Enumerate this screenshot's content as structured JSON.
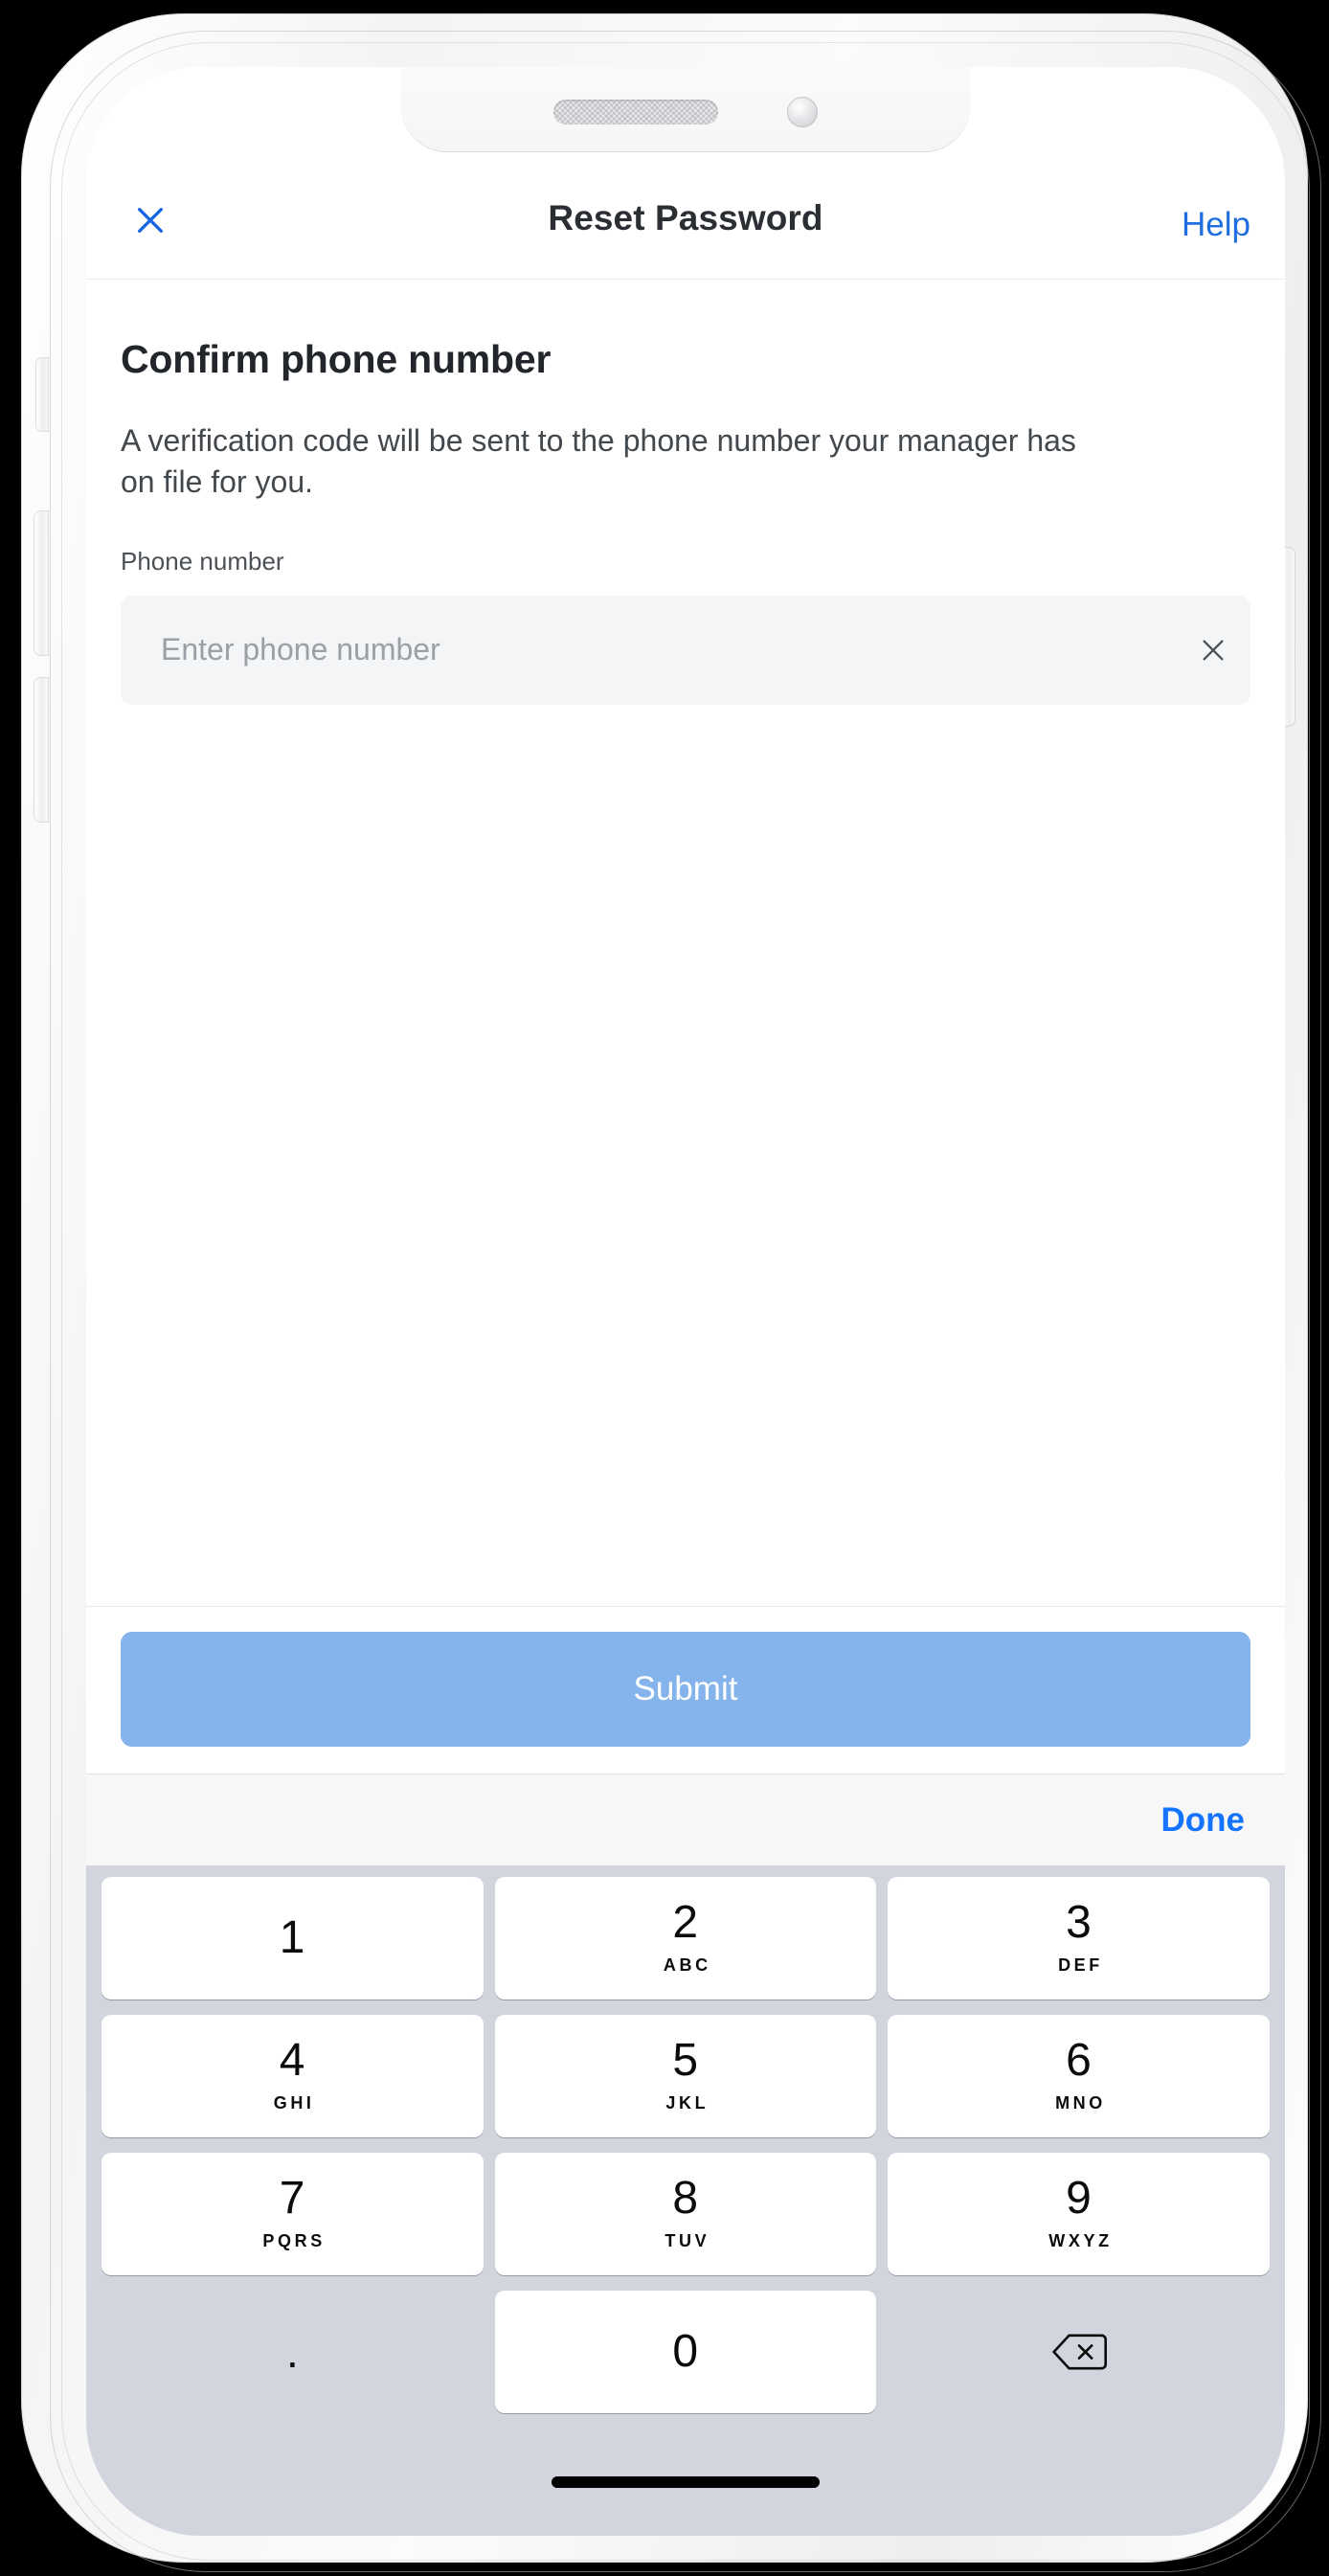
{
  "device": {
    "type": "smartphone-mockup",
    "notch": {
      "speaker": "speaker-grille",
      "camera": "front-camera"
    },
    "buttons": [
      "mute-switch",
      "volume-up",
      "volume-down",
      "power-button"
    ],
    "home_indicator": true
  },
  "nav": {
    "close_icon": "close-x-icon",
    "title": "Reset Password",
    "help_label": "Help",
    "link_color": "#1f6fe0"
  },
  "content": {
    "heading": "Confirm phone number",
    "description": "A verification code will be sent to the phone number your manager has on file for you.",
    "field_label": "Phone number",
    "input": {
      "value": "",
      "placeholder": "Enter phone number",
      "clear_icon": "close-x-icon"
    }
  },
  "actions": {
    "submit_label": "Submit",
    "submit_color": "#85b4ec",
    "done_label": "Done",
    "done_color": "#1574ff"
  },
  "keypad": {
    "background_color": "#d2d5dd",
    "rows": [
      [
        {
          "digit": "1",
          "letters": ""
        },
        {
          "digit": "2",
          "letters": "ABC"
        },
        {
          "digit": "3",
          "letters": "DEF"
        }
      ],
      [
        {
          "digit": "4",
          "letters": "GHI"
        },
        {
          "digit": "5",
          "letters": "JKL"
        },
        {
          "digit": "6",
          "letters": "MNO"
        }
      ],
      [
        {
          "digit": "7",
          "letters": "PQRS"
        },
        {
          "digit": "8",
          "letters": "TUV"
        },
        {
          "digit": "9",
          "letters": "WXYZ"
        }
      ]
    ],
    "bottom_row": {
      "dot_label": ".",
      "zero_digit": "0",
      "delete_icon": "backspace-delete-icon"
    }
  }
}
